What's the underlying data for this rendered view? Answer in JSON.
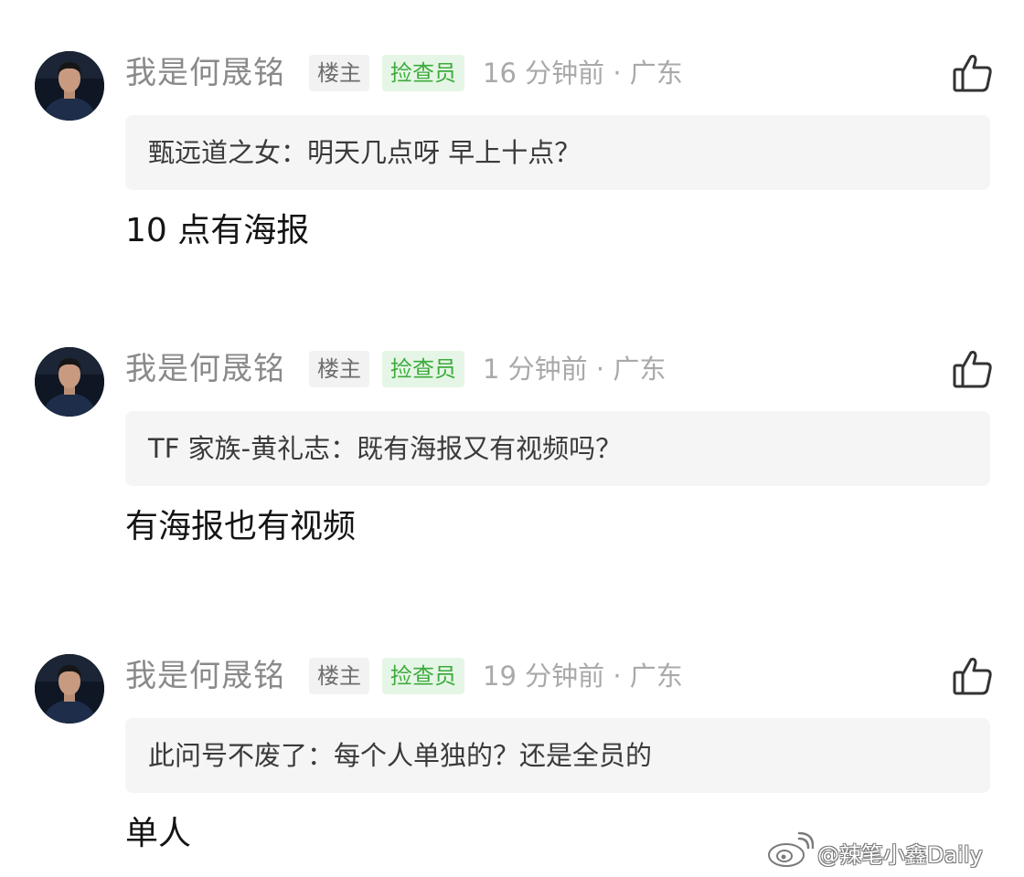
{
  "comments": [
    {
      "avatar_icon": "user-avatar-icon",
      "username": "我是何晟铭",
      "badges": {
        "owner": "楼主",
        "checker": "捡查员"
      },
      "meta": "16 分钟前 · 广东",
      "quote": "甄远道之女：明天几点呀 早上十点？",
      "reply": "10 点有海报",
      "like_icon": "thumbs-up-icon"
    },
    {
      "avatar_icon": "user-avatar-icon",
      "username": "我是何晟铭",
      "badges": {
        "owner": "楼主",
        "checker": "捡查员"
      },
      "meta": "1 分钟前 · 广东",
      "quote": "TF 家族-黄礼志：既有海报又有视频吗？",
      "reply": "有海报也有视频",
      "like_icon": "thumbs-up-icon"
    },
    {
      "avatar_icon": "user-avatar-icon",
      "username": "我是何晟铭",
      "badges": {
        "owner": "楼主",
        "checker": "捡查员"
      },
      "meta": "19 分钟前 · 广东",
      "quote": "此问号不废了：每个人单独的？还是全员的",
      "reply": "单人",
      "like_icon": "thumbs-up-icon"
    }
  ],
  "watermark": {
    "icon": "weibo-logo-icon",
    "text": "@辣笔小鑫Daily"
  },
  "colors": {
    "background": "#ffffff",
    "username": "#8a8a8a",
    "owner_badge_bg": "#f2f2f2",
    "checker_badge_bg": "#e6f6e6",
    "checker_badge_text": "#3cab3c",
    "meta": "#a9a9a9",
    "quote_bg": "#f5f5f5",
    "reply_text": "#141414"
  }
}
